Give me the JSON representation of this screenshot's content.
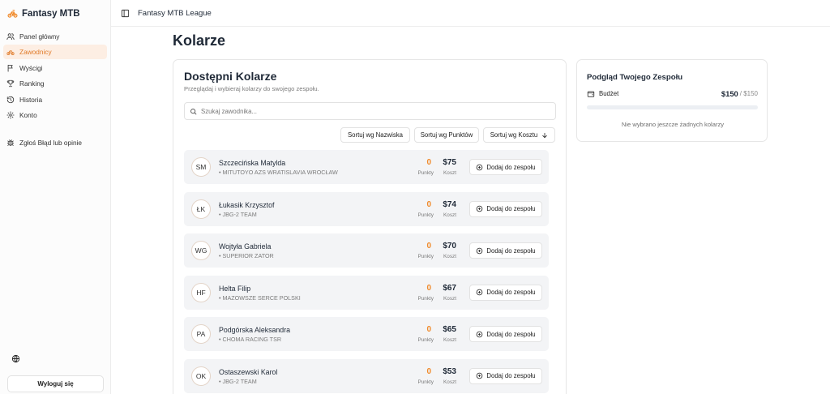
{
  "app": {
    "name": "Fantasy MTB",
    "header_title": "Fantasy MTB League"
  },
  "sidebar": {
    "items": [
      {
        "label": "Panel główny",
        "icon": "users-icon",
        "active": false
      },
      {
        "label": "Zawodnicy",
        "icon": "bike-icon",
        "active": true
      },
      {
        "label": "Wyścigi",
        "icon": "flag-icon",
        "active": false
      },
      {
        "label": "Ranking",
        "icon": "trophy-icon",
        "active": false
      },
      {
        "label": "Historia",
        "icon": "history-icon",
        "active": false
      },
      {
        "label": "Konto",
        "icon": "settings-icon",
        "active": false
      }
    ],
    "feedback_label": "Zgłoś Błąd lub opinie",
    "logout_label": "Wyloguj się"
  },
  "page": {
    "title": "Kolarze"
  },
  "riders_card": {
    "title": "Dostępni Kolarze",
    "subtitle": "Przeglądaj i wybieraj kolarzy do swojego zespołu.",
    "search_placeholder": "Szukaj zawodnika...",
    "sort": {
      "by_name": "Sortuj wg Nazwiska",
      "by_points": "Sortuj wg Punktów",
      "by_cost": "Sortuj wg Kosztu"
    },
    "points_label": "Punkty",
    "cost_label": "Koszt",
    "add_label": "Dodaj do zespołu",
    "riders": [
      {
        "initials": "SM",
        "name": "Szczecińska Matylda",
        "team": "• MITUTOYO AZS WRATISLAVIA WROCŁAW",
        "points": "0",
        "cost": "$75"
      },
      {
        "initials": "ŁK",
        "name": "Łukasik Krzysztof",
        "team": "• JBG-2 TEAM",
        "points": "0",
        "cost": "$74"
      },
      {
        "initials": "WG",
        "name": "Wojtyła Gabriela",
        "team": "• SUPERIOR ZATOR",
        "points": "0",
        "cost": "$70"
      },
      {
        "initials": "HF",
        "name": "Helta Filip",
        "team": "• MAZOWSZE SERCE POLSKI",
        "points": "0",
        "cost": "$67"
      },
      {
        "initials": "PA",
        "name": "Podgórska Aleksandra",
        "team": "• CHOMA RACING TSR",
        "points": "0",
        "cost": "$65"
      },
      {
        "initials": "OK",
        "name": "Ostaszewski Karol",
        "team": "• JBG-2 TEAM",
        "points": "0",
        "cost": "$53"
      }
    ]
  },
  "team_card": {
    "title": "Podgląd Twojego Zespołu",
    "budget_label": "Budżet",
    "budget_value": "$150",
    "budget_max": "/ $150",
    "budget_used_fraction": 0,
    "empty_note": "Nie wybrano jeszcze żadnych kolarzy"
  },
  "colors": {
    "accent": "#f08a2b",
    "active_bg": "#fdeee3",
    "row_bg": "#f3f4f6"
  }
}
